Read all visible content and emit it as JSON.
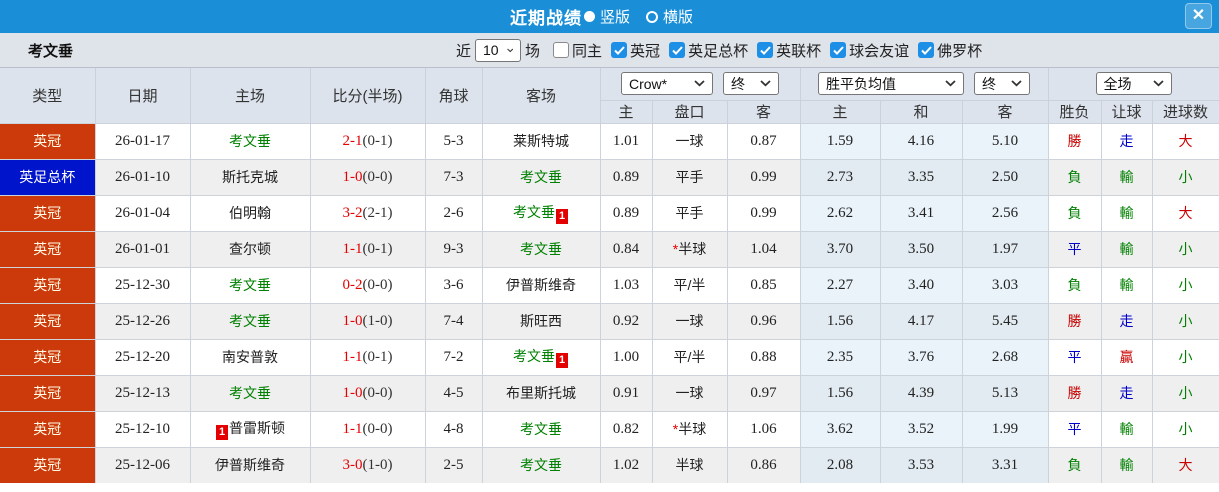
{
  "titlebar": {
    "title": "近期战绩",
    "layout_options": [
      {
        "label": "竖版",
        "selected": true
      },
      {
        "label": "横版",
        "selected": false
      }
    ],
    "close_glyph": "✕"
  },
  "filterbar": {
    "team": "考文垂",
    "recent_label": "近",
    "recent_count": "10",
    "matches_label": "场",
    "checkboxes": [
      {
        "label": "同主",
        "checked": false
      },
      {
        "label": "英冠",
        "checked": true
      },
      {
        "label": "英足总杯",
        "checked": true
      },
      {
        "label": "英联杯",
        "checked": true
      },
      {
        "label": "球会友谊",
        "checked": true
      },
      {
        "label": "佛罗杯",
        "checked": true
      }
    ]
  },
  "table": {
    "left_headers": [
      "类型",
      "日期",
      "主场",
      "比分(半场)",
      "角球",
      "客场"
    ],
    "selects": {
      "odds_source": "Crow*",
      "odds_state": "终",
      "avg_label": "胜平负均值",
      "avg_state": "终",
      "fulltime": "全场"
    },
    "sub_headers": [
      "主",
      "盘口",
      "客",
      "主",
      "和",
      "客",
      "胜负",
      "让球",
      "进球数"
    ],
    "rows": [
      {
        "type": "英冠",
        "type_color": "red",
        "date": "26-01-17",
        "home": {
          "name": "考文垂",
          "green": true,
          "badge": null,
          "badge_pos": null
        },
        "score": "2-1",
        "half": "(0-1)",
        "corners": "5-3",
        "away": {
          "name": "莱斯特城",
          "green": false,
          "badge": null,
          "badge_pos": null
        },
        "odds": [
          "1.01",
          "一球",
          "0.87"
        ],
        "handicap_star": false,
        "avg": [
          "1.59",
          "4.16",
          "5.10"
        ],
        "results": [
          {
            "text": "勝",
            "color": "red"
          },
          {
            "text": "走",
            "color": "blue"
          },
          {
            "text": "大",
            "color": "red"
          }
        ]
      },
      {
        "type": "英足总杯",
        "type_color": "blue",
        "date": "26-01-10",
        "home": {
          "name": "斯托克城",
          "green": false,
          "badge": null,
          "badge_pos": null
        },
        "score": "1-0",
        "half": "(0-0)",
        "corners": "7-3",
        "away": {
          "name": "考文垂",
          "green": true,
          "badge": null,
          "badge_pos": null
        },
        "odds": [
          "0.89",
          "平手",
          "0.99"
        ],
        "handicap_star": false,
        "avg": [
          "2.73",
          "3.35",
          "2.50"
        ],
        "results": [
          {
            "text": "負",
            "color": "green"
          },
          {
            "text": "輸",
            "color": "green"
          },
          {
            "text": "小",
            "color": "green"
          }
        ]
      },
      {
        "type": "英冠",
        "type_color": "red",
        "date": "26-01-04",
        "home": {
          "name": "伯明翰",
          "green": false,
          "badge": null,
          "badge_pos": null
        },
        "score": "3-2",
        "half": "(2-1)",
        "corners": "2-6",
        "away": {
          "name": "考文垂",
          "green": true,
          "badge": "1",
          "badge_pos": "after"
        },
        "odds": [
          "0.89",
          "平手",
          "0.99"
        ],
        "handicap_star": false,
        "avg": [
          "2.62",
          "3.41",
          "2.56"
        ],
        "results": [
          {
            "text": "負",
            "color": "green"
          },
          {
            "text": "輸",
            "color": "green"
          },
          {
            "text": "大",
            "color": "red"
          }
        ]
      },
      {
        "type": "英冠",
        "type_color": "red",
        "date": "26-01-01",
        "home": {
          "name": "查尔顿",
          "green": false,
          "badge": null,
          "badge_pos": null
        },
        "score": "1-1",
        "half": "(0-1)",
        "corners": "9-3",
        "away": {
          "name": "考文垂",
          "green": true,
          "badge": null,
          "badge_pos": null
        },
        "odds": [
          "0.84",
          "半球",
          "1.04"
        ],
        "handicap_star": true,
        "avg": [
          "3.70",
          "3.50",
          "1.97"
        ],
        "results": [
          {
            "text": "平",
            "color": "blue"
          },
          {
            "text": "輸",
            "color": "green"
          },
          {
            "text": "小",
            "color": "green"
          }
        ]
      },
      {
        "type": "英冠",
        "type_color": "red",
        "date": "25-12-30",
        "home": {
          "name": "考文垂",
          "green": true,
          "badge": null,
          "badge_pos": null
        },
        "score": "0-2",
        "half": "(0-0)",
        "corners": "3-6",
        "away": {
          "name": "伊普斯维奇",
          "green": false,
          "badge": null,
          "badge_pos": null
        },
        "odds": [
          "1.03",
          "平/半",
          "0.85"
        ],
        "handicap_star": false,
        "avg": [
          "2.27",
          "3.40",
          "3.03"
        ],
        "results": [
          {
            "text": "負",
            "color": "green"
          },
          {
            "text": "輸",
            "color": "green"
          },
          {
            "text": "小",
            "color": "green"
          }
        ]
      },
      {
        "type": "英冠",
        "type_color": "red",
        "date": "25-12-26",
        "home": {
          "name": "考文垂",
          "green": true,
          "badge": null,
          "badge_pos": null
        },
        "score": "1-0",
        "half": "(1-0)",
        "corners": "7-4",
        "away": {
          "name": "斯旺西",
          "green": false,
          "badge": null,
          "badge_pos": null
        },
        "odds": [
          "0.92",
          "一球",
          "0.96"
        ],
        "handicap_star": false,
        "avg": [
          "1.56",
          "4.17",
          "5.45"
        ],
        "results": [
          {
            "text": "勝",
            "color": "red"
          },
          {
            "text": "走",
            "color": "blue"
          },
          {
            "text": "小",
            "color": "green"
          }
        ]
      },
      {
        "type": "英冠",
        "type_color": "red",
        "date": "25-12-20",
        "home": {
          "name": "南安普敦",
          "green": false,
          "badge": null,
          "badge_pos": null
        },
        "score": "1-1",
        "half": "(0-1)",
        "corners": "7-2",
        "away": {
          "name": "考文垂",
          "green": true,
          "badge": "1",
          "badge_pos": "after"
        },
        "odds": [
          "1.00",
          "平/半",
          "0.88"
        ],
        "handicap_star": false,
        "avg": [
          "2.35",
          "3.76",
          "2.68"
        ],
        "results": [
          {
            "text": "平",
            "color": "blue"
          },
          {
            "text": "贏",
            "color": "red"
          },
          {
            "text": "小",
            "color": "green"
          }
        ]
      },
      {
        "type": "英冠",
        "type_color": "red",
        "date": "25-12-13",
        "home": {
          "name": "考文垂",
          "green": true,
          "badge": null,
          "badge_pos": null
        },
        "score": "1-0",
        "half": "(0-0)",
        "corners": "4-5",
        "away": {
          "name": "布里斯托城",
          "green": false,
          "badge": null,
          "badge_pos": null
        },
        "odds": [
          "0.91",
          "一球",
          "0.97"
        ],
        "handicap_star": false,
        "avg": [
          "1.56",
          "4.39",
          "5.13"
        ],
        "results": [
          {
            "text": "勝",
            "color": "red"
          },
          {
            "text": "走",
            "color": "blue"
          },
          {
            "text": "小",
            "color": "green"
          }
        ]
      },
      {
        "type": "英冠",
        "type_color": "red",
        "date": "25-12-10",
        "home": {
          "name": "普雷斯顿",
          "green": false,
          "badge": "1",
          "badge_pos": "before"
        },
        "score": "1-1",
        "half": "(0-0)",
        "corners": "4-8",
        "away": {
          "name": "考文垂",
          "green": true,
          "badge": null,
          "badge_pos": null
        },
        "odds": [
          "0.82",
          "半球",
          "1.06"
        ],
        "handicap_star": true,
        "avg": [
          "3.62",
          "3.52",
          "1.99"
        ],
        "results": [
          {
            "text": "平",
            "color": "blue"
          },
          {
            "text": "輸",
            "color": "green"
          },
          {
            "text": "小",
            "color": "green"
          }
        ]
      },
      {
        "type": "英冠",
        "type_color": "red",
        "date": "25-12-06",
        "home": {
          "name": "伊普斯维奇",
          "green": false,
          "badge": null,
          "badge_pos": null
        },
        "score": "3-0",
        "half": "(1-0)",
        "corners": "2-5",
        "away": {
          "name": "考文垂",
          "green": true,
          "badge": null,
          "badge_pos": null
        },
        "odds": [
          "1.02",
          "半球",
          "0.86"
        ],
        "handicap_star": false,
        "avg": [
          "2.08",
          "3.53",
          "3.31"
        ],
        "results": [
          {
            "text": "負",
            "color": "green"
          },
          {
            "text": "輸",
            "color": "green"
          },
          {
            "text": "大",
            "color": "red"
          }
        ]
      }
    ]
  },
  "colors": {
    "titlebar": "#1a8fd8",
    "league_red": "#cc3a0c",
    "league_blue": "#0014cc",
    "team_green": "#008000",
    "score_red": "#e60000",
    "result_red": "#c80000",
    "result_green": "#008000",
    "result_blue": "#0000c8"
  }
}
